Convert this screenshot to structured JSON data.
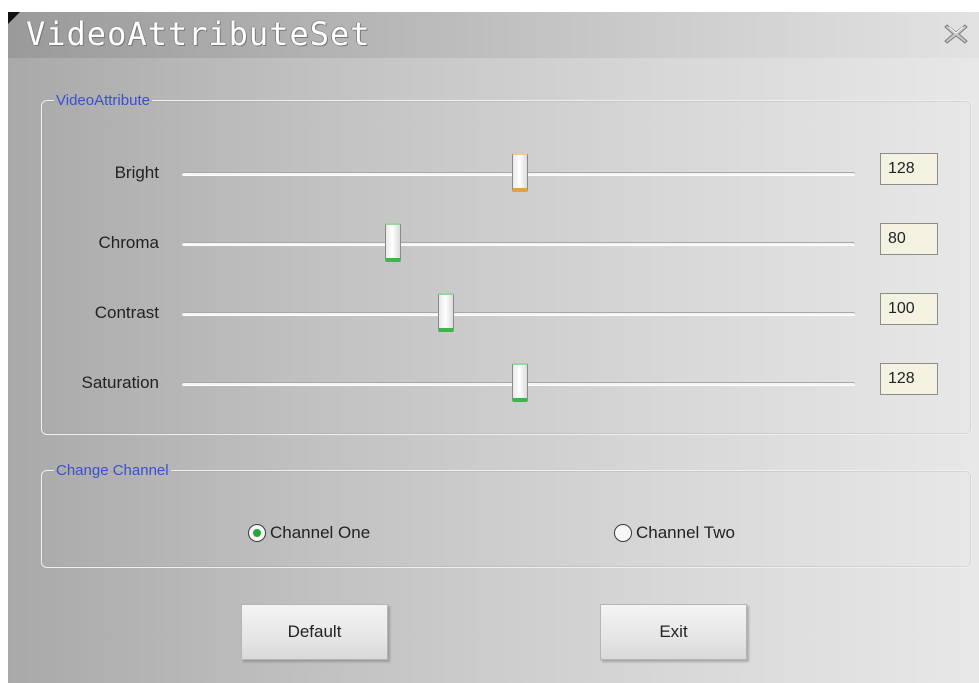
{
  "window": {
    "title": "VideoAttributeSet"
  },
  "video_attribute": {
    "legend": "VideoAttribute",
    "sliders": [
      {
        "label": "Bright",
        "value": "128",
        "position": 128,
        "max": 255,
        "accent": "#e3a144"
      },
      {
        "label": "Chroma",
        "value": "80",
        "position": 80,
        "max": 255,
        "accent": "#3bb74a"
      },
      {
        "label": "Contrast",
        "value": "100",
        "position": 100,
        "max": 255,
        "accent": "#3bb74a"
      },
      {
        "label": "Saturation",
        "value": "128",
        "position": 128,
        "max": 255,
        "accent": "#3bb74a"
      }
    ]
  },
  "change_channel": {
    "legend": "Change Channel",
    "options": [
      {
        "label": "Channel One",
        "selected": true
      },
      {
        "label": "Channel Two",
        "selected": false
      }
    ]
  },
  "buttons": {
    "default_label": "Default",
    "exit_label": "Exit"
  },
  "colors": {
    "legend_text": "#3b4fd4",
    "value_box_bg": "#f4f3e2",
    "radio_dot": "#25a83a"
  },
  "icons": {
    "close": "close-icon"
  }
}
